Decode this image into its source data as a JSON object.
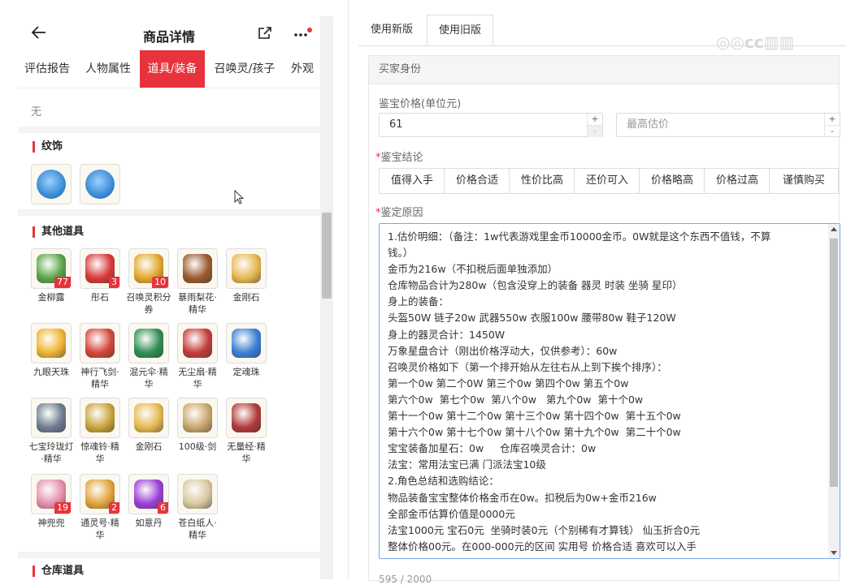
{
  "mobile": {
    "title": "商品详情",
    "tabs": [
      "评估报告",
      "人物属性",
      "道具/装备",
      "召唤灵/孩子",
      "外观"
    ],
    "active_tab": "道具/装备",
    "none_text": "无",
    "sections": {
      "wenshi": "纹饰",
      "other_items": "其他道具",
      "warehouse": "仓库道具"
    },
    "items": [
      {
        "name": "金柳露",
        "count": "77",
        "color": "#5aa64a"
      },
      {
        "name": "彤石",
        "count": "3",
        "color": "#d9393b"
      },
      {
        "name": "召唤灵积分券",
        "count": "10",
        "color": "#e2a72e"
      },
      {
        "name": "暴雨梨花·精华",
        "count": "",
        "color": "#9a5a2e"
      },
      {
        "name": "金刚石",
        "count": "",
        "color": "#e6b850"
      },
      {
        "name": "九眼天珠",
        "count": "",
        "color": "#f0b433"
      },
      {
        "name": "神行飞剑·精华",
        "count": "",
        "color": "#d4463a"
      },
      {
        "name": "混元伞·精华",
        "count": "",
        "color": "#2f8f55"
      },
      {
        "name": "无尘扇·精华",
        "count": "",
        "color": "#c63b3b"
      },
      {
        "name": "定魂珠",
        "count": "",
        "color": "#3b7fd6"
      },
      {
        "name": "七宝玲珑灯·精华",
        "count": "",
        "color": "#6f7d92"
      },
      {
        "name": "惊魂铃·精华",
        "count": "",
        "color": "#c9a43a"
      },
      {
        "name": "金刚石",
        "count": "",
        "color": "#e6b850"
      },
      {
        "name": "100级·剑",
        "count": "",
        "color": "#c9a66b"
      },
      {
        "name": "无量经·精华",
        "count": "",
        "color": "#b23a3a"
      },
      {
        "name": "神兜兜",
        "count": "19",
        "color": "#e78fb0"
      },
      {
        "name": "通灵号·精华",
        "count": "2",
        "color": "#e0a43a"
      },
      {
        "name": "如意丹",
        "count": "6",
        "color": "#9b3fd6"
      },
      {
        "name": "苍白纸人·精华",
        "count": "",
        "color": "#d9c9a0"
      }
    ],
    "wenshi_colors": [
      "#3a8bd6",
      "#3a8bd6"
    ]
  },
  "right": {
    "tabs": [
      "使用新版",
      "使用旧版"
    ],
    "active_tab": "使用旧版",
    "card_title": "买家身份",
    "price_label": "鉴宝价格(单位元)",
    "price_value": "61",
    "max_placeholder": "最高估价",
    "conclusion_label": "鉴宝结论",
    "conclusion_options": [
      "值得入手",
      "价格合适",
      "性价比高",
      "还价可入",
      "价格略高",
      "价格过高",
      "谨慎购买"
    ],
    "reason_label": "鉴定原因",
    "reason_lines": [
      "1.估价明细：（备注：1w代表游戏里金币10000金币。0W就是这个东西不值钱，不算",
      "钱。）",
      "金币为216w（不扣税后面单独添加）",
      "仓库物品合计为280w（包含没穿上的装备 器灵 时装 坐骑 星印）",
      "身上的装备：",
      "头盔50W 链子20w 武器550w 衣服100w 腰带80w 鞋子120W",
      "身上的器灵合计：1450W",
      "万象星盘合计（刚出价格浮动大，仅供参考）：60w",
      "召唤灵价格如下（第一个排开始从左往右从上到下挨个排序）：",
      "第一个0w 第二个0W 第三个0w 第四个0w 第五个0w",
      "第六个0w  第七个0w  第八个0w   第九个0w  第十个0w",
      "第十一个0w 第十二个0w 第十三个0w 第十四个0w  第十五个0w",
      "第十六个0w 第十七个0w 第十八个0w 第十九个0w  第二十个0w",
      "宝宝装备加星石：0w     仓库召唤灵合计：0w",
      "法宝：常用法宝已满 门派法宝10级",
      "2.角色总结和选购结论：",
      "物品装备宝宝整体价格金币在0w。扣税后为0w+金币216w",
      "全部金币估算价值是0000元",
      "法宝1000元 宝石0元  坐骑时装0元（个别稀有才算钱） 仙玉折合0元",
      "整体价格00元。在000-000元的区间 实用号 价格合适 喜欢可以入手"
    ],
    "counter": "595 / 2000"
  }
}
